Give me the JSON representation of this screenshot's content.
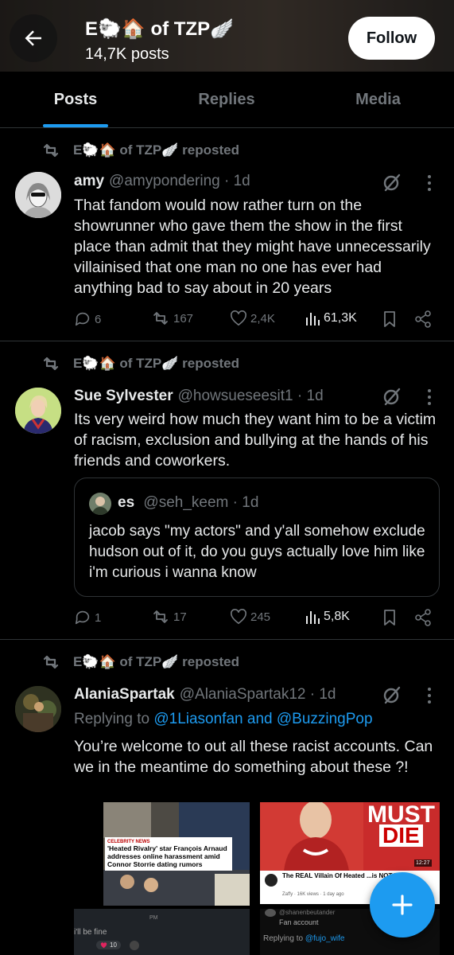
{
  "header": {
    "title": "E🐑🏠 of TZP🪽",
    "posts_count": "14,7K posts",
    "follow_label": "Follow"
  },
  "tabs": [
    {
      "label": "Posts",
      "active": true
    },
    {
      "label": "Replies",
      "active": false
    },
    {
      "label": "Media",
      "active": false
    }
  ],
  "tweets": [
    {
      "reposted_by": "E🐑🏠 of TZP🪽 reposted",
      "name": "amy",
      "handle": "@amypondering · 1d",
      "text": "That fandom would now rather turn on the showrunner who gave them the show in the first place than admit that they might have unnecessarily villainised that one man no one has ever had anything bad to say about in 20 years",
      "replies": "6",
      "reposts": "167",
      "likes": "2,4K",
      "views": "61,3K"
    },
    {
      "reposted_by": "E🐑🏠 of TZP🪽 reposted",
      "name": "Sue Sylvester",
      "handle": "@howsueseesit1 · 1d",
      "text": "Its very weird how much they want him to be a victim of racism, exclusion and bullying at the hands of his friends and coworkers.",
      "quote": {
        "name": "es",
        "handle": "@seh_keem · 1d",
        "text": "jacob says \"my actors\" and y'all somehow exclude hudson out of it, do you guys actually love him like i'm curious i wanna know"
      },
      "replies": "1",
      "reposts": "17",
      "likes": "245",
      "views": "5,8K"
    },
    {
      "reposted_by": "E🐑🏠 of TZP🪽 reposted",
      "name": "AlaniaSpartak",
      "handle": "@AlaniaSpartak12 · 1d",
      "replying_prefix": "Replying to ",
      "replying_to": "@1Liasonfan and @BuzzingPop",
      "text": "You’re welcome to out all these racist accounts. Can we in the meantime do something about these ?!",
      "media": {
        "img1_tag": "CELEBRITY NEWS",
        "img1_headline": "'Heated Rivalry' star François Arnaud addresses online harassment amid Connor Storrie dating rumors",
        "img2_top": "MUST",
        "img2_bottom": "DIE",
        "img2_time": "12:27",
        "img2_caption": "The REAL Villain Of Heated ...is NOT Wh...",
        "img2_meta": "Zaffy · 16K views · 1 day ago",
        "img3_label": "i'll be fine",
        "img3_time": "PM",
        "img3_likes": "10",
        "img4_line1": "@shanenbeutander",
        "img4_line2": "Fan account",
        "img4_reply_prefix": "Replying to ",
        "img4_reply_to": "@fujo_wife"
      }
    }
  ],
  "colors": {
    "accent": "#1d9bf0",
    "text": "#e7e9ea",
    "muted": "#71767b",
    "border": "#2f3336"
  }
}
